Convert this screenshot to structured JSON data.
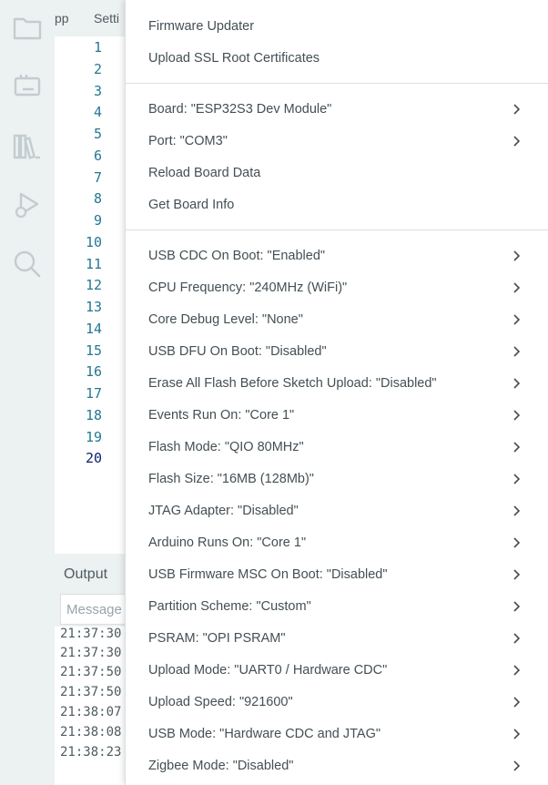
{
  "tabs": [
    "pp",
    "Setti"
  ],
  "editor": {
    "line_numbers": [
      "1",
      "2",
      "3",
      "4",
      "5",
      "6",
      "7",
      "8",
      "9",
      "10",
      "11",
      "12",
      "13",
      "14",
      "15",
      "16",
      "17",
      "18",
      "19",
      "20"
    ],
    "active_line": "20"
  },
  "output": {
    "title": "Output",
    "input_placeholder": "Message",
    "log_lines": [
      "21:37:30",
      "21:37:30",
      "21:37:50",
      "21:37:50",
      "21:38:07",
      "21:38:08",
      "21:38:23"
    ]
  },
  "menu": {
    "group1": [
      "Firmware Updater",
      "Upload SSL Root Certificates"
    ],
    "group2": [
      {
        "label": "Board: \"ESP32S3 Dev Module\"",
        "submenu": true
      },
      {
        "label": "Port: \"COM3\"",
        "submenu": true
      },
      {
        "label": "Reload Board Data",
        "submenu": false
      },
      {
        "label": "Get Board Info",
        "submenu": false
      }
    ],
    "group3": [
      "USB CDC On Boot: \"Enabled\"",
      "CPU Frequency: \"240MHz (WiFi)\"",
      "Core Debug Level: \"None\"",
      "USB DFU On Boot: \"Disabled\"",
      "Erase All Flash Before Sketch Upload: \"Disabled\"",
      "Events Run On: \"Core 1\"",
      "Flash Mode: \"QIO 80MHz\"",
      "Flash Size: \"16MB (128Mb)\"",
      "JTAG Adapter: \"Disabled\"",
      "Arduino Runs On: \"Core 1\"",
      "USB Firmware MSC On Boot: \"Disabled\"",
      "Partition Scheme: \"Custom\"",
      "PSRAM: \"OPI PSRAM\"",
      "Upload Mode: \"UART0 / Hardware CDC\"",
      "Upload Speed: \"921600\"",
      "USB Mode: \"Hardware CDC and JTAG\"",
      "Zigbee Mode: \"Disabled\""
    ]
  },
  "activity_bar": [
    "folder-icon",
    "board-manager-icon",
    "library-manager-icon",
    "debug-icon",
    "search-icon"
  ],
  "colors": {
    "sidebar_bg": "#ecf1f1",
    "icon": "#c3ccd0",
    "line_number": "#237893",
    "menu_text": "#434f54",
    "separator": "#dadfe0"
  }
}
